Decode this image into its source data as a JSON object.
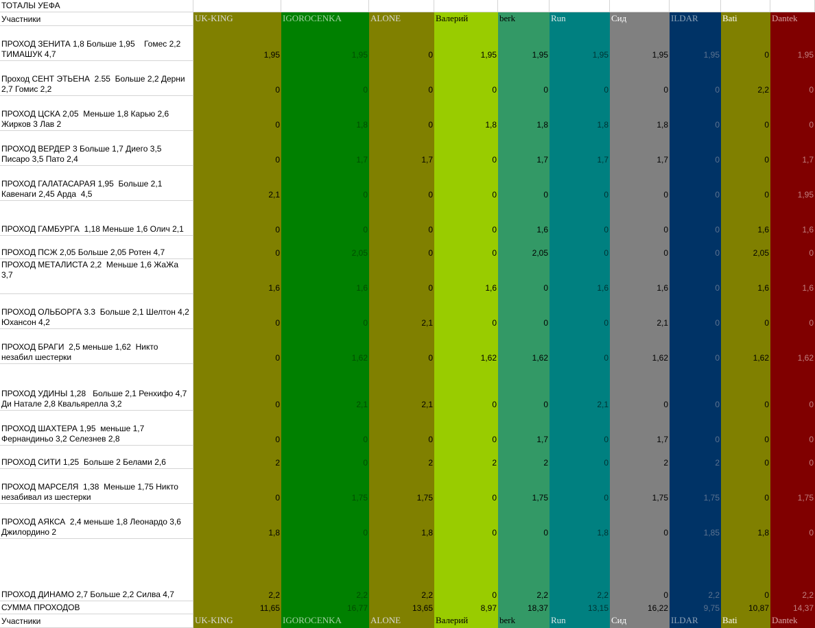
{
  "sheet": {
    "title": "ТОТАЛЫ УЕФА",
    "participants_label": "Участники",
    "sum_label": "СУММА ПРОХОДОВ"
  },
  "players": [
    {
      "name": "UK-KING",
      "color": "#808000",
      "header_text_color": "#d9d9d9",
      "text_color": "#000000"
    },
    {
      "name": "IGOROCENKA",
      "color": "#008000",
      "header_text_color": "#a6d4a6",
      "text_color": "#004d00"
    },
    {
      "name": "ALONE",
      "color": "#808000",
      "header_text_color": "#d9d9d9",
      "text_color": "#000000"
    },
    {
      "name": "Валерий",
      "color": "#99cc00",
      "header_text_color": "#000000",
      "text_color": "#000000"
    },
    {
      "name": "berk",
      "color": "#339966",
      "header_text_color": "#000000",
      "text_color": "#000000"
    },
    {
      "name": "Run",
      "color": "#008080",
      "header_text_color": "#d9e8e8",
      "text_color": "#003333"
    },
    {
      "name": "Сид",
      "color": "#808080",
      "header_text_color": "#ffffff",
      "text_color": "#000000"
    },
    {
      "name": "ILDAR",
      "color": "#003366",
      "header_text_color": "#8ea3b8",
      "text_color": "#5c7390"
    },
    {
      "name": "Bati",
      "color": "#808000",
      "header_text_color": "#ffffff",
      "text_color": "#000000"
    },
    {
      "name": "Dantek",
      "color": "#800000",
      "header_text_color": "#d9a6a6",
      "text_color": "#c08080"
    }
  ],
  "rows": [
    {
      "label": "ПРОХОД ЗЕНИТА 1,8 Больше 1,95    Гомес 2,2 ТИМАШУК 4,7",
      "values": [
        "1,95",
        "1,95",
        "0",
        "1,95",
        "1,95",
        "1,95",
        "1,95",
        "1,95",
        "0",
        "1,95"
      ]
    },
    {
      "label": "Проход СЕНТ ЭТЬЕНА  2.55  Больше 2,2 Дерни 2,7 Гомис 2,2",
      "values": [
        "0",
        "0",
        "0",
        "0",
        "0",
        "0",
        "0",
        "0",
        "2,2",
        "0"
      ]
    },
    {
      "label": "ПРОХОД ЦСКА 2,05  Меньше 1,8 Карью 2,6 Жирков 3 Лав 2",
      "values": [
        "0",
        "1,8",
        "0",
        "1,8",
        "1,8",
        "1,8",
        "1,8",
        "0",
        "0",
        "0"
      ]
    },
    {
      "label": "ПРОХОД ВЕРДЕР 3 Больше 1,7 Диего 3,5 Писаро 3,5 Пато 2,4",
      "values": [
        "0",
        "1,7",
        "1,7",
        "0",
        "1,7",
        "1,7",
        "1,7",
        "0",
        "0",
        "1,7"
      ]
    },
    {
      "label": "ПРОХОД ГАЛАТАСАРАЯ 1,95  Больше 2,1 Кавенаги 2,45 Арда  4,5",
      "values": [
        "2,1",
        "0",
        "0",
        "0",
        "0",
        "0",
        "0",
        "0",
        "0",
        "1,95"
      ]
    },
    {
      "label": "ПРОХОД ГАМБУРГА  1,18 Меньше 1,6 Олич 2,1",
      "values": [
        "0",
        "0",
        "0",
        "0",
        "1,6",
        "0",
        "0",
        "0",
        "1,6",
        "1,6"
      ]
    },
    {
      "label": "ПРОХОД ПСЖ 2,05 Больше 2,05 Ротен 4,7",
      "values": [
        "0",
        "2,05",
        "0",
        "0",
        "2,05",
        "0",
        "0",
        "0",
        "2,05",
        "0"
      ]
    },
    {
      "label": "ПРОХОД МЕТАЛИСТА 2,2  Меньше 1,6 ЖаЖа 3,7",
      "values": [
        "1,6",
        "1,6",
        "0",
        "1,6",
        "0",
        "1,6",
        "1,6",
        "0",
        "1,6",
        "1,6"
      ]
    },
    {
      "label": "ПРОХОД ОЛЬБОРГА 3.3  Больше 2,1 Шелтон 4,2 Юхансон 4,2",
      "values": [
        "0",
        "0",
        "2,1",
        "0",
        "0",
        "0",
        "2,1",
        "0",
        "0",
        "0"
      ]
    },
    {
      "label": "ПРОХОД БРАГИ  2,5 меньше 1,62  Никто незабил шестерки",
      "values": [
        "0",
        "1,62",
        "0",
        "1,62",
        "1,62",
        "0",
        "1,62",
        "0",
        "1,62",
        "1,62"
      ]
    },
    {
      "label": "ПРОХОД УДИНЫ 1,28   Больше 2,1 Ренхифо 4,7  Ди Натале 2,8 Квальярелла 3,2",
      "values": [
        "0",
        "2,1",
        "2,1",
        "0",
        "0",
        "2,1",
        "0",
        "0",
        "0",
        "0"
      ]
    },
    {
      "label": "ПРОХОД ШАХТЕРА 1,95  меньше 1,7 Фернандиньо 3,2 Селезнев 2,8",
      "values": [
        "0",
        "0",
        "0",
        "0",
        "1,7",
        "0",
        "1,7",
        "0",
        "0",
        "0"
      ]
    },
    {
      "label": "ПРОХОД СИТИ 1,25  Больше 2 Белами 2,6",
      "values": [
        "2",
        "0",
        "2",
        "2",
        "2",
        "0",
        "2",
        "2",
        "0",
        "0"
      ]
    },
    {
      "label": "ПРОХОД МАРСЕЛЯ  1,38  Меньше 1,75 Никто незабивал из шестерки",
      "values": [
        "0",
        "1,75",
        "1,75",
        "0",
        "1,75",
        "0",
        "1,75",
        "1,75",
        "0",
        "1,75"
      ]
    },
    {
      "label": "ПРОХОД АЯКСА  2,4 меньше 1,8 Леонардо 3,6 Джилордино 2",
      "values": [
        "1,8",
        "0",
        "1,8",
        "0",
        "0",
        "1,8",
        "0",
        "1,85",
        "1,8",
        "0"
      ]
    },
    {
      "label": "ПРОХОД ДИНАМО 2,7 Больше 2,2 Силва 4,7",
      "values": [
        "2,2",
        "2,2",
        "2,2",
        "0",
        "2,2",
        "2,2",
        "0",
        "2,2",
        "0",
        "2,2"
      ]
    }
  ],
  "totals": [
    "11,65",
    "16,77",
    "13,65",
    "8,97",
    "18,37",
    "13,15",
    "16,22",
    "9,75",
    "10,87",
    "14,37"
  ]
}
